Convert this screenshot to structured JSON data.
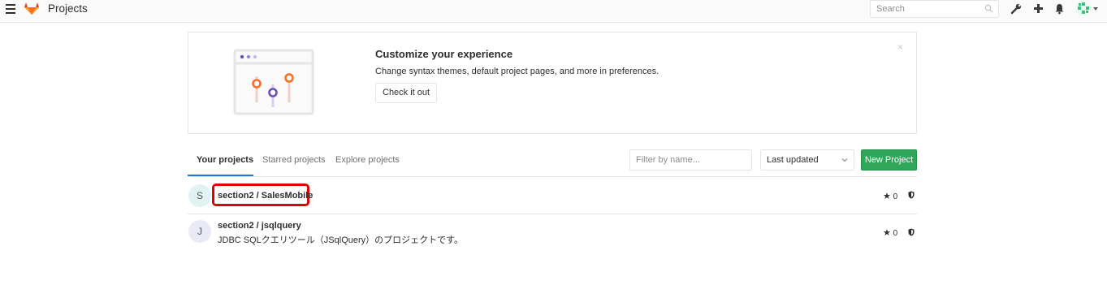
{
  "header": {
    "title": "Projects",
    "search_placeholder": "Search"
  },
  "banner": {
    "title": "Customize your experience",
    "text": "Change syntax themes, default project pages, and more in preferences.",
    "button": "Check it out",
    "close": "×"
  },
  "tabs": [
    {
      "label": "Your projects",
      "active": true
    },
    {
      "label": "Starred projects",
      "active": false
    },
    {
      "label": "Explore projects",
      "active": false
    }
  ],
  "filter_placeholder": "Filter by name...",
  "sort_label": "Last updated",
  "new_project_label": "New Project",
  "projects": [
    {
      "avatar_letter": "S",
      "name": "section2 / SalesMobile",
      "description": "",
      "stars": "0",
      "highlighted": true
    },
    {
      "avatar_letter": "J",
      "name": "section2 / jsqlquery",
      "description": "JDBC SQLクエリツール（JSqlQuery）のプロジェクトです。",
      "stars": "0",
      "highlighted": false
    }
  ],
  "colors": {
    "accent_blue": "#1f78d1",
    "new_button_green": "#2fa65a",
    "highlight_red": "#e00000",
    "illustration_orange": "#fc6d26",
    "illustration_purple": "#6b4fbb"
  },
  "icons": [
    "hamburger-icon",
    "gitlab-logo",
    "search-icon",
    "wrench-icon",
    "plus-icon",
    "bell-icon",
    "user-avatar",
    "star-icon",
    "shield-icon",
    "chevron-down-icon"
  ]
}
